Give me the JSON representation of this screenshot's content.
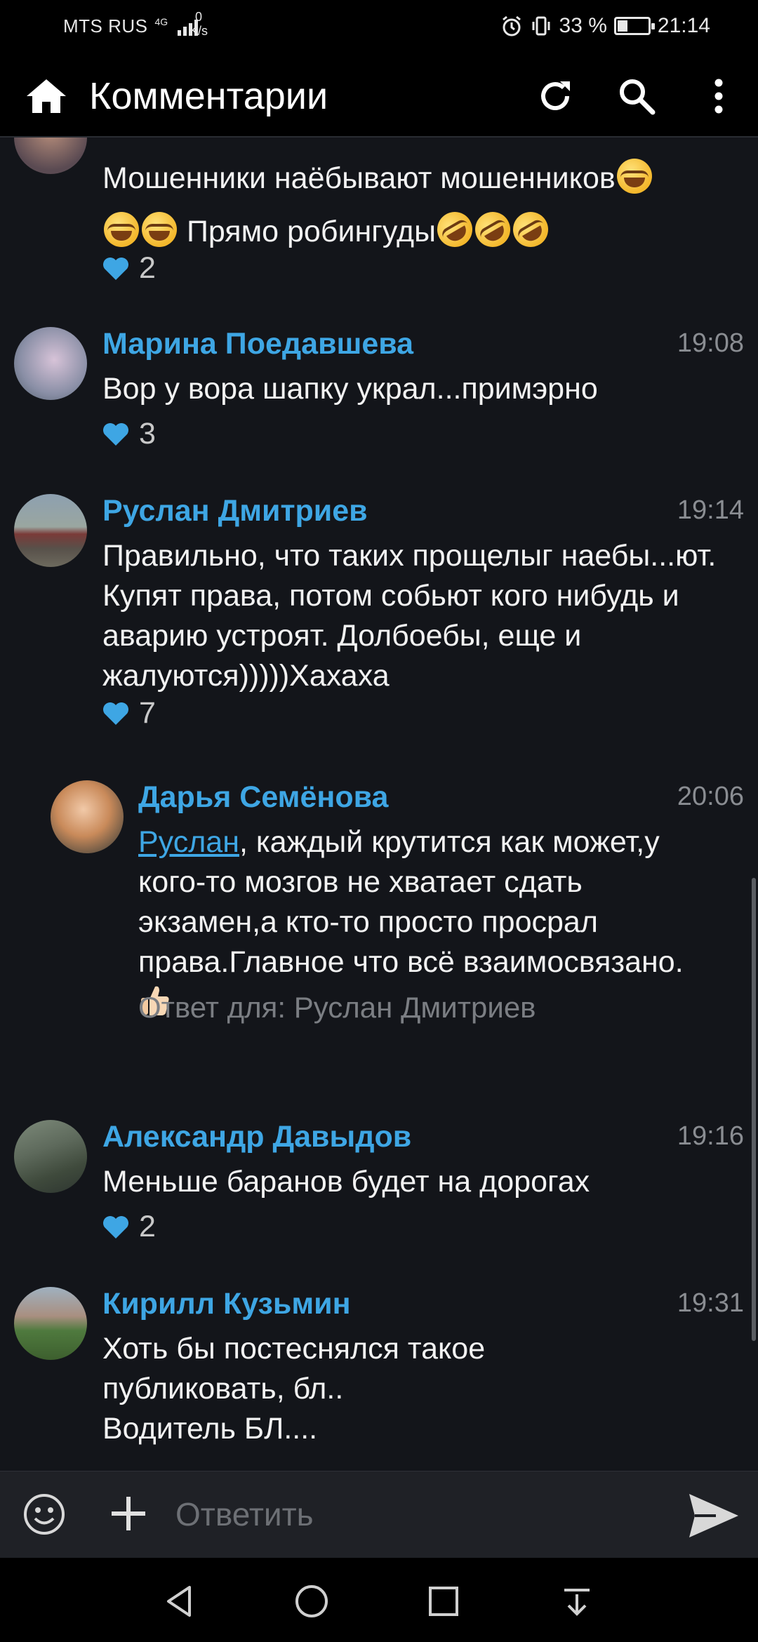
{
  "status_bar": {
    "carrier": "MTS RUS",
    "network": "4G",
    "speed_value": "0",
    "speed_unit": "K/s",
    "battery": "33 %",
    "battery_level": 0.33,
    "time": "21:14"
  },
  "app_bar": {
    "title": "Комментарии"
  },
  "comments": [
    {
      "author": "",
      "time": "",
      "text_line1": "Мошенники наёбывают мошенников",
      "text_line2": "Прямо робингуды",
      "likes": "2"
    },
    {
      "author": "Марина Поедавшева",
      "time": "19:08",
      "text": "Вор у вора шапку украл...примэрно",
      "likes": "3"
    },
    {
      "author": "Руслан Дмитриев",
      "time": "19:14",
      "text": "Правильно, что таких прощелыг наебы...ют. Купят права, потом собьют кого нибудь и аварию устроят. Долбоебы, еще и жалуются)))))Хахаха",
      "likes": "7"
    },
    {
      "author": "Дарья Семёнова",
      "time": "20:06",
      "mention": "Руслан",
      "text": ", каждый крутится как может,у кого-то мозгов не хватает сдать экзамен,а кто-то просто просрал права.Главное что всё взаимосвязано.",
      "reply_to": "Ответ для: Руслан Дмитриев"
    },
    {
      "author": "Александр Давыдов",
      "time": "19:16",
      "text": "Меньше баранов будет на дорогах",
      "likes": "2"
    },
    {
      "author": "Кирилл Кузьмин",
      "time": "19:31",
      "text_line1": "Хоть бы постеснялся такое",
      "text_line2": "публиковать, бл..",
      "text_line3": "Водитель БЛ...."
    }
  ],
  "input": {
    "placeholder": "Ответить"
  },
  "colors": {
    "accent": "#3ea6e4",
    "background": "#13151a",
    "heart": "#3ea6e4"
  }
}
